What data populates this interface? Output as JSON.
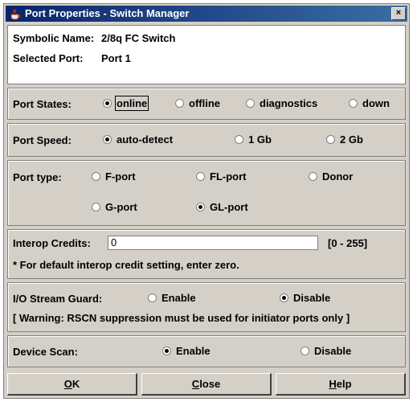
{
  "window": {
    "title": "Port Properties - Switch Manager",
    "close_label": "×"
  },
  "info": {
    "symbolic_name_label": "Symbolic Name:",
    "symbolic_name_value": "2/8q FC Switch",
    "selected_port_label": "Selected Port:",
    "selected_port_value": "Port 1"
  },
  "port_states": {
    "label": "Port States:",
    "options": [
      "online",
      "offline",
      "diagnostics",
      "down"
    ],
    "selected": "online"
  },
  "port_speed": {
    "label": "Port Speed:",
    "options": [
      "auto-detect",
      "1 Gb",
      "2 Gb"
    ],
    "selected": "auto-detect"
  },
  "port_type": {
    "label": "Port type:",
    "options": [
      "F-port",
      "FL-port",
      "Donor",
      "G-port",
      "GL-port"
    ],
    "selected": "GL-port"
  },
  "interop": {
    "label": "Interop Credits:",
    "value": "0",
    "range": "[0 - 255]",
    "note": "* For default interop credit setting, enter zero."
  },
  "io_stream_guard": {
    "label": "I/O Stream Guard:",
    "options": [
      "Enable",
      "Disable"
    ],
    "selected": "Disable",
    "warning": "[ Warning: RSCN suppression must be used for initiator ports only ]"
  },
  "device_scan": {
    "label": "Device Scan:",
    "options": [
      "Enable",
      "Disable"
    ],
    "selected": "Enable"
  },
  "buttons": {
    "ok_mnemonic": "O",
    "ok_rest": "K",
    "close_mnemonic": "C",
    "close_rest": "lose",
    "help_mnemonic": "H",
    "help_rest": "elp"
  },
  "colors": {
    "titlebar": "#0a246a",
    "dialog_bg": "#d4d0c8"
  }
}
